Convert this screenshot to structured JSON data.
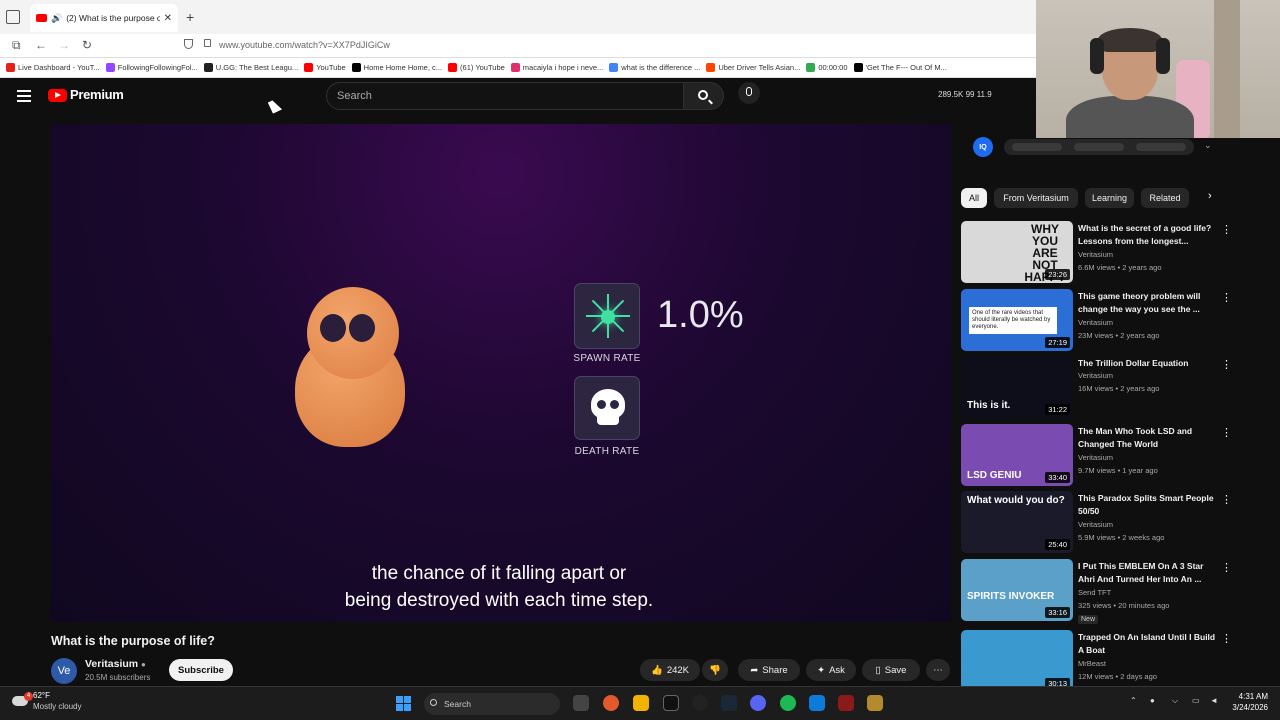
{
  "browser": {
    "tab_title": "(2) What is the purpose of l",
    "url": "www.youtube.com/watch?v=XX7PdJIGiCw",
    "bookmarks": [
      {
        "label": "Live Dashboard - YouT...",
        "color": "#e62117"
      },
      {
        "label": "FollowingFollowingFol...",
        "color": "#9146ff"
      },
      {
        "label": "U.GG: The Best Leagu...",
        "color": "#222222"
      },
      {
        "label": "YouTube",
        "color": "#ff0000"
      },
      {
        "label": "Home Home Home, c...",
        "color": "#000000"
      },
      {
        "label": "(61) YouTube",
        "color": "#ff0000"
      },
      {
        "label": "macaiyla i hope i neve...",
        "color": "#e1306c"
      },
      {
        "label": "what is the difference ...",
        "color": "#4285f4"
      },
      {
        "label": "Uber Driver Tells Asian...",
        "color": "#ff4500"
      },
      {
        "label": "00:00:00",
        "color": "#34a853"
      },
      {
        "label": "'Get The F--- Out Of M...",
        "color": "#000000"
      }
    ]
  },
  "youtube": {
    "logo_text": "Premium",
    "search_placeholder": "Search",
    "stats": "289.5K   99   11.9"
  },
  "video": {
    "spawn_pct": "1.0%",
    "spawn_label": "SPAWN RATE",
    "death_label": "DEATH RATE",
    "caption_line1": "the chance of it falling apart or",
    "caption_line2": "being destroyed with each time step.",
    "title": "What is the purpose of life?",
    "channel": "Veritasium",
    "channel_initials": "Ve",
    "subscribers": "20.5M subscribers",
    "subscribe_label": "Subscribe",
    "likes": "242K",
    "share_label": "Share",
    "ask_label": "Ask",
    "save_label": "Save"
  },
  "sidebar": {
    "iq_badge": "IQ",
    "chips": [
      "All",
      "From Veritasium",
      "Learning",
      "Related"
    ],
    "recommendations": [
      {
        "title": "What is the secret of a good life? Lessons from the longest...",
        "channel": "Veritasium",
        "meta": "6.6M views • 2 years ago",
        "duration": "23:26",
        "thumb_text": "WHY YOU ARE NOT HAPPY",
        "thumb_color": "#d9d9d9"
      },
      {
        "title": "This game theory problem will change the way you see the ...",
        "channel": "Veritasium",
        "meta": "23M views • 2 years ago",
        "duration": "27:19",
        "thumb_text": "One of the rare videos that should literally be watched by everyone.",
        "thumb_color": "#2b6fd6"
      },
      {
        "title": "The Trillion Dollar Equation",
        "channel": "Veritasium",
        "meta": "16M views • 2 years ago",
        "duration": "31:22",
        "thumb_text": "This is it.",
        "thumb_color": "#0e0e1a"
      },
      {
        "title": "The Man Who Took LSD and Changed The World",
        "channel": "Veritasium",
        "meta": "9.7M views • 1 year ago",
        "duration": "33:40",
        "thumb_text": "LSD GENIU",
        "thumb_color": "#7a4bb0"
      },
      {
        "title": "This Paradox Splits Smart People 50/50",
        "channel": "Veritasium",
        "meta": "5.9M views • 2 weeks ago",
        "duration": "25:40",
        "thumb_text": "What would you do?",
        "thumb_color": "#1a1a2a"
      },
      {
        "title": "I Put This EMBLEM On A 3 Star Ahri And Turned Her Into An ...",
        "channel": "Send TFT",
        "meta": "325 views • 20 minutes ago",
        "duration": "33:16",
        "thumb_text": "SPIRITS INVOKER",
        "thumb_color": "#5aa0c8",
        "badge": "New"
      },
      {
        "title": "Trapped On An Island Until I Build A Boat",
        "channel": "MrBeast",
        "meta": "12M views • 2 days ago",
        "duration": "30:13",
        "thumb_text": "",
        "thumb_color": "#3a9ad0"
      }
    ]
  },
  "taskbar": {
    "temp": "62°F",
    "weather": "Mostly cloudy",
    "search": "Search",
    "time": "4:31 AM",
    "date": "3/24/2026"
  }
}
